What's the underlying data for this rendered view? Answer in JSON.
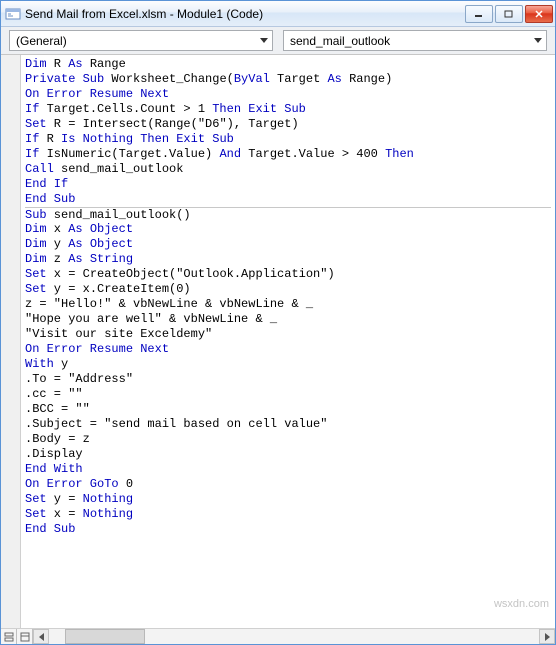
{
  "window": {
    "title": "Send Mail from Excel.xlsm - Module1 (Code)"
  },
  "dropdowns": {
    "object": "(General)",
    "procedure": "send_mail_outlook"
  },
  "code": {
    "lines": [
      [
        [
          "kw",
          "Dim"
        ],
        [
          "txt",
          " R "
        ],
        [
          "kw",
          "As"
        ],
        [
          "txt",
          " Range"
        ]
      ],
      [
        [
          "kw",
          "Private Sub"
        ],
        [
          "txt",
          " Worksheet_Change("
        ],
        [
          "kw",
          "ByVal"
        ],
        [
          "txt",
          " Target "
        ],
        [
          "kw",
          "As"
        ],
        [
          "txt",
          " Range)"
        ]
      ],
      [
        [
          "kw",
          "On Error Resume Next"
        ]
      ],
      [
        [
          "kw",
          "If"
        ],
        [
          "txt",
          " Target.Cells.Count > 1 "
        ],
        [
          "kw",
          "Then Exit Sub"
        ]
      ],
      [
        [
          "kw",
          "Set"
        ],
        [
          "txt",
          " R = Intersect(Range(\"D6\"), Target)"
        ]
      ],
      [
        [
          "kw",
          "If"
        ],
        [
          "txt",
          " R "
        ],
        [
          "kw",
          "Is Nothing Then Exit Sub"
        ]
      ],
      [
        [
          "kw",
          "If"
        ],
        [
          "txt",
          " IsNumeric(Target.Value) "
        ],
        [
          "kw",
          "And"
        ],
        [
          "txt",
          " Target.Value > 400 "
        ],
        [
          "kw",
          "Then"
        ]
      ],
      [
        [
          "kw",
          "Call"
        ],
        [
          "txt",
          " send_mail_outlook"
        ]
      ],
      [
        [
          "kw",
          "End If"
        ]
      ],
      [
        [
          "kw",
          "End Sub"
        ]
      ],
      [
        [
          "kw",
          "Sub"
        ],
        [
          "txt",
          " send_mail_outlook()"
        ]
      ],
      [
        [
          "kw",
          "Dim"
        ],
        [
          "txt",
          " x "
        ],
        [
          "kw",
          "As Object"
        ]
      ],
      [
        [
          "kw",
          "Dim"
        ],
        [
          "txt",
          " y "
        ],
        [
          "kw",
          "As Object"
        ]
      ],
      [
        [
          "kw",
          "Dim"
        ],
        [
          "txt",
          " z "
        ],
        [
          "kw",
          "As String"
        ]
      ],
      [
        [
          "kw",
          "Set"
        ],
        [
          "txt",
          " x = CreateObject(\"Outlook.Application\")"
        ]
      ],
      [
        [
          "kw",
          "Set"
        ],
        [
          "txt",
          " y = x.CreateItem(0)"
        ]
      ],
      [
        [
          "txt",
          "z = \"Hello!\" & vbNewLine & vbNewLine & _"
        ]
      ],
      [
        [
          "txt",
          "\"Hope you are well\" & vbNewLine & _"
        ]
      ],
      [
        [
          "txt",
          "\"Visit our site Exceldemy\""
        ]
      ],
      [
        [
          "kw",
          "On Error Resume Next"
        ]
      ],
      [
        [
          "kw",
          "With"
        ],
        [
          "txt",
          " y"
        ]
      ],
      [
        [
          "txt",
          ".To = \"Address\""
        ]
      ],
      [
        [
          "txt",
          ".cc = \"\""
        ]
      ],
      [
        [
          "txt",
          ".BCC = \"\""
        ]
      ],
      [
        [
          "txt",
          ".Subject = \"send mail based on cell value\""
        ]
      ],
      [
        [
          "txt",
          ".Body = z"
        ]
      ],
      [
        [
          "txt",
          ".Display"
        ]
      ],
      [
        [
          "kw",
          "End With"
        ]
      ],
      [
        [
          "kw",
          "On Error GoTo"
        ],
        [
          "txt",
          " 0"
        ]
      ],
      [
        [
          "kw",
          "Set"
        ],
        [
          "txt",
          " y = "
        ],
        [
          "kw",
          "Nothing"
        ]
      ],
      [
        [
          "kw",
          "Set"
        ],
        [
          "txt",
          " x = "
        ],
        [
          "kw",
          "Nothing"
        ]
      ],
      [
        [
          "kw",
          "End Sub"
        ]
      ]
    ],
    "separator_after_line": 10
  },
  "watermark": "wsxdn.com"
}
